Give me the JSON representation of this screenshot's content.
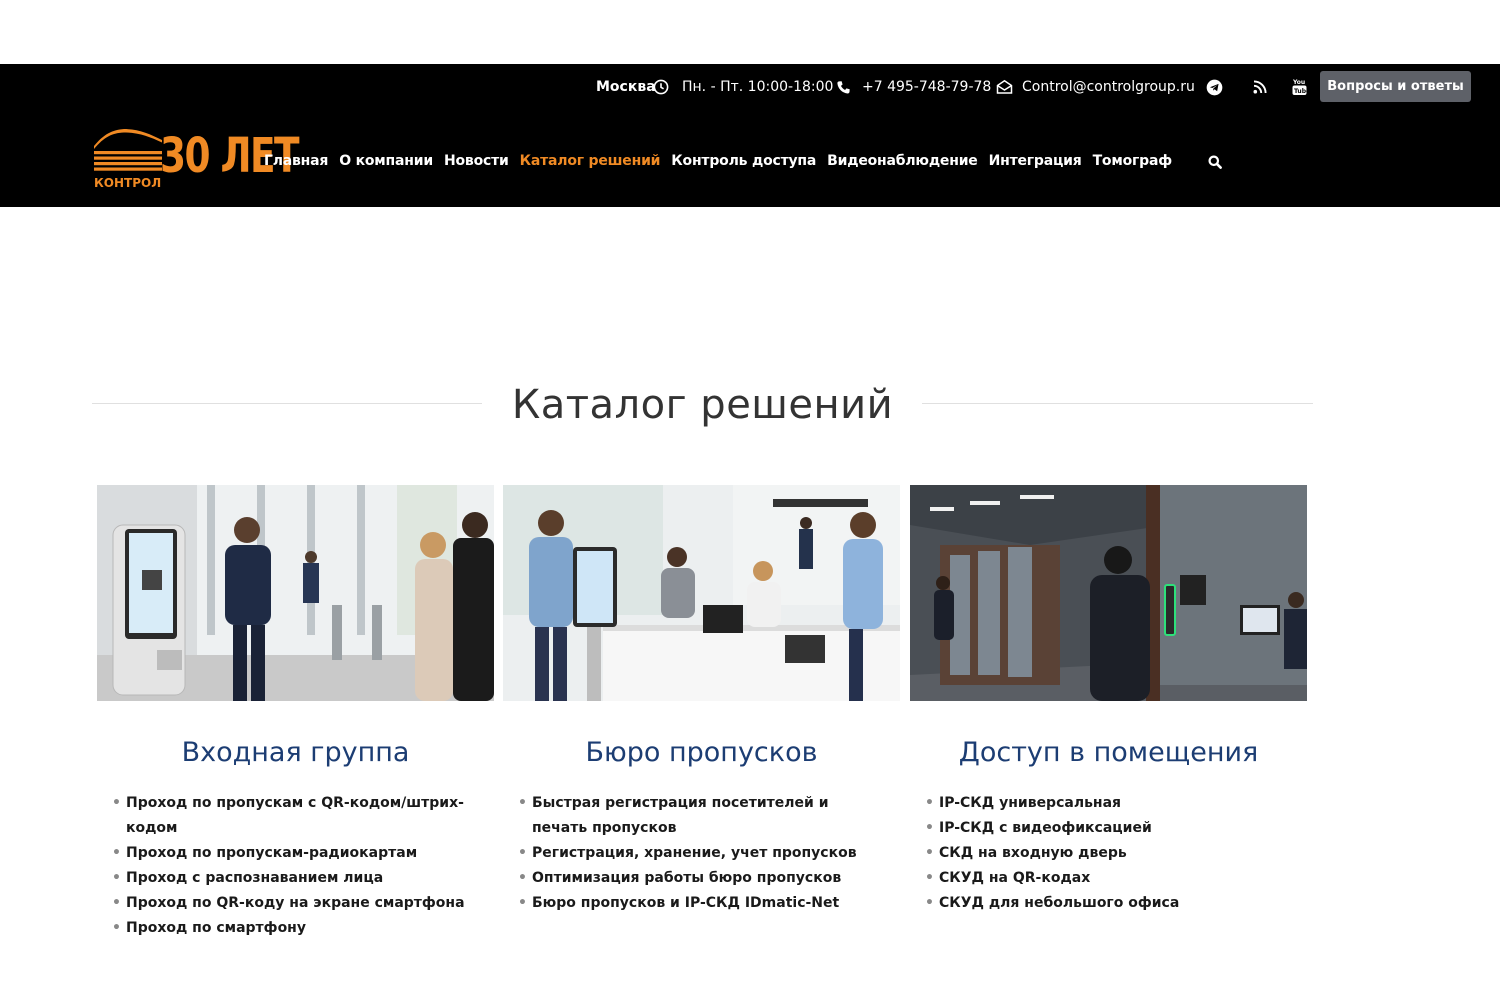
{
  "topbar": {
    "city": "Москва",
    "hours": "Пн. - Пт. 10:00-18:00",
    "phone": "+7 495-748-79-78",
    "email": "Control@controlgroup.ru",
    "faq_button": "Вопросы и ответы",
    "icons": [
      "clock-icon",
      "phone-icon",
      "mail-icon",
      "telegram-icon",
      "rss-icon",
      "youtube-icon"
    ]
  },
  "logo": {
    "text": "КОНТРОЛ",
    "years": "30 ЛЕТ",
    "color": "#f08a24"
  },
  "nav": {
    "items": [
      "Главная",
      "О компании",
      "Новости",
      "Каталог решений",
      "Контроль доступа",
      "Видеонаблюдение",
      "Интеграция",
      "Томограф"
    ],
    "active_index": 3,
    "active_color": "#f08a24"
  },
  "page": {
    "title": "Каталог решений"
  },
  "cards": [
    {
      "title": "Входная группа",
      "items": [
        "Проход по пропускам с QR-кодом/штрих-кодом",
        "Проход по пропускам-радиокартам",
        "Проход с распознаванием лица",
        "Проход по QR-коду на экране смартфона",
        "Проход по смартфону"
      ]
    },
    {
      "title": "Бюро пропусков",
      "items": [
        "Быстрая регистрация посетителей и печать пропусков",
        "Регистрация, хранение, учет пропусков",
        "Оптимизация работы бюро пропусков",
        "Бюро пропусков и IP-СКД IDmatic-Net"
      ]
    },
    {
      "title": "Доступ в помещения",
      "items": [
        "IP-СКД универсальная",
        "IP-СКД с видеофиксацией",
        "СКД на входную дверь",
        "СКУД на QR-кодах",
        "СКУД для небольшого офиса"
      ]
    }
  ],
  "colors": {
    "header_bg": "#000000",
    "card_title": "#1c3d73",
    "faq_button_bg": "#5e6168"
  }
}
